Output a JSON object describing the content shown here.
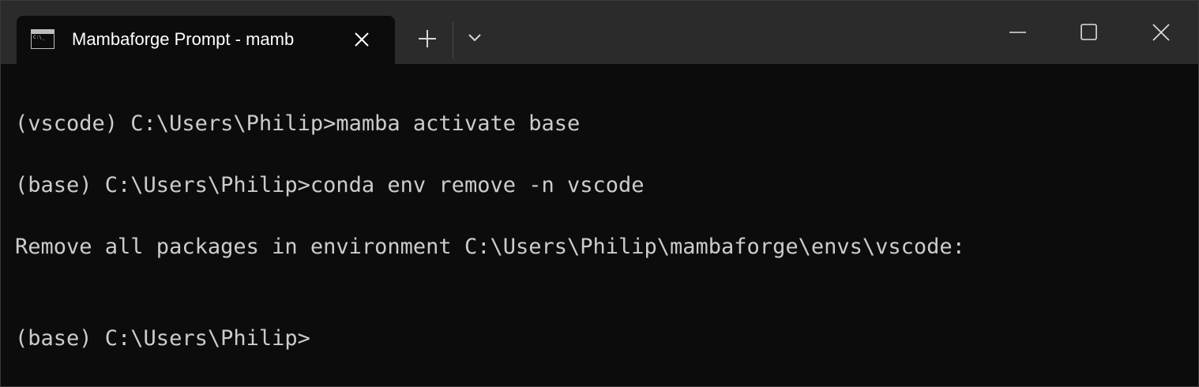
{
  "tab": {
    "title": "Mambaforge Prompt - mamb",
    "icon": "console-icon"
  },
  "icons": {
    "tab_close": "close-icon",
    "new_tab": "plus-icon",
    "dropdown": "chevron-down-icon",
    "minimize": "minimize-icon",
    "maximize": "maximize-icon",
    "close_window": "close-icon"
  },
  "terminal": {
    "lines": [
      "(vscode) C:\\Users\\Philip>mamba activate base",
      "(base) C:\\Users\\Philip>conda env remove -n vscode",
      "Remove all packages in environment C:\\Users\\Philip\\mambaforge\\envs\\vscode:",
      "(base) C:\\Users\\Philip>"
    ]
  },
  "colors": {
    "background": "#0c0c0c",
    "titlebar": "#2b2b2b",
    "text": "#cccccc"
  }
}
